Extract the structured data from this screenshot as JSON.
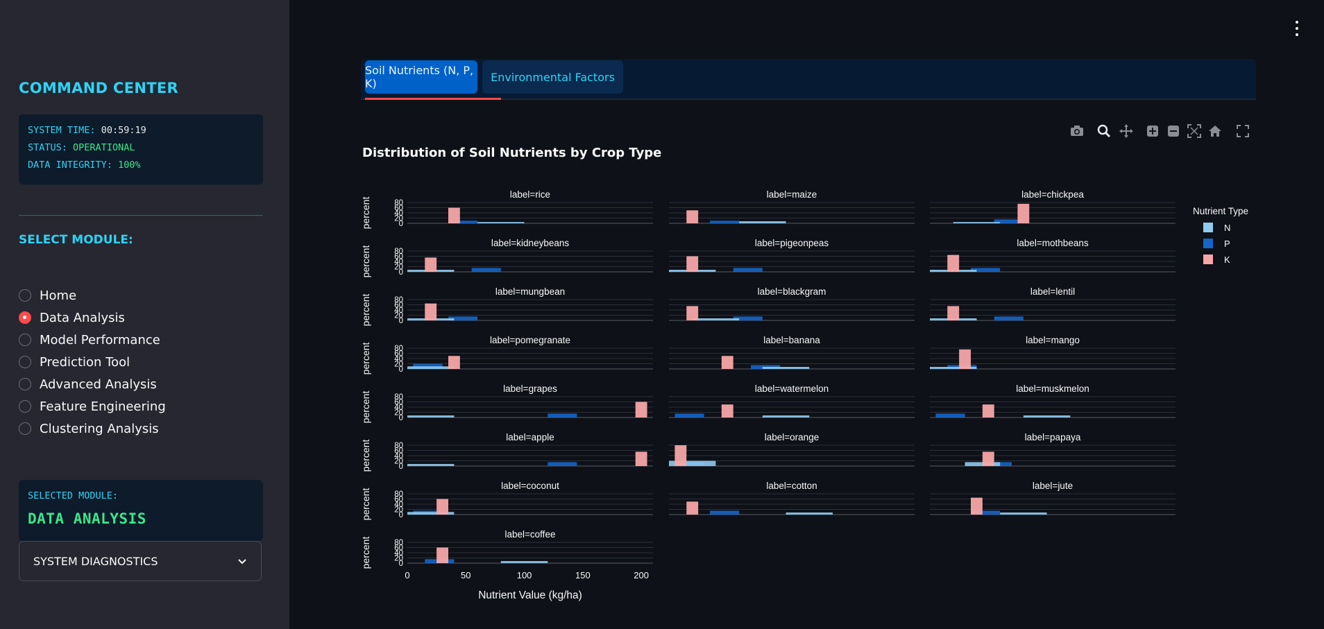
{
  "sidebar": {
    "title": "COMMAND CENTER",
    "system": {
      "time_label": "SYSTEM TIME:",
      "time_value": "00:59:19",
      "status_label": "STATUS:",
      "status_value": "OPERATIONAL",
      "integrity_label": "DATA INTEGRITY:",
      "integrity_value": "100%"
    },
    "select_title": "SELECT MODULE:",
    "modules": [
      {
        "label": "Home",
        "selected": false
      },
      {
        "label": "Data Analysis",
        "selected": true
      },
      {
        "label": "Model Performance",
        "selected": false
      },
      {
        "label": "Prediction Tool",
        "selected": false
      },
      {
        "label": "Advanced Analysis",
        "selected": false
      },
      {
        "label": "Feature Engineering",
        "selected": false
      },
      {
        "label": "Clustering Analysis",
        "selected": false
      }
    ],
    "selected_module_label": "SELECTED MODULE:",
    "selected_module_value": "DATA ANALYSIS",
    "diagnostics_label": "SYSTEM DIAGNOSTICS"
  },
  "tabs": [
    {
      "label": "Soil Nutrients (N, P, K)",
      "active": true
    },
    {
      "label": "Environmental Factors",
      "active": false
    }
  ],
  "modebar_icons": [
    "camera-icon",
    "zoom-icon",
    "pan-icon",
    "zoom-in-icon",
    "zoom-out-icon",
    "autoscale-icon",
    "home-icon",
    "fullscreen-icon"
  ],
  "chart_data": {
    "type": "histogram",
    "title": "Distribution of Soil Nutrients by Crop Type",
    "xlabel": "Nutrient Value (kg/ha)",
    "ylabel": "percent",
    "xlim": [
      0,
      210
    ],
    "ylim": [
      0,
      80
    ],
    "xticks": [
      0,
      50,
      100,
      150,
      200
    ],
    "yticks": [
      0,
      20,
      40,
      60,
      80
    ],
    "legend": {
      "title": "Nutrient Type",
      "position": "right"
    },
    "colors": {
      "N": "#8fcbf0",
      "P": "#1565c8",
      "K": "#f7a6a6"
    },
    "facets": [
      {
        "label": "label=rice",
        "N": [
          [
            60,
            100,
            5
          ]
        ],
        "P": [
          [
            35,
            60,
            10
          ]
        ],
        "K": [
          [
            35,
            45,
            60
          ]
        ]
      },
      {
        "label": "label=maize",
        "N": [
          [
            60,
            100,
            8
          ]
        ],
        "P": [
          [
            35,
            60,
            10
          ]
        ],
        "K": [
          [
            15,
            25,
            50
          ]
        ]
      },
      {
        "label": "label=chickpea",
        "N": [
          [
            20,
            60,
            5
          ]
        ],
        "P": [
          [
            55,
            80,
            15
          ]
        ],
        "K": [
          [
            75,
            85,
            75
          ]
        ]
      },
      {
        "label": "label=kidneybeans",
        "N": [
          [
            0,
            40,
            8
          ]
        ],
        "P": [
          [
            55,
            80,
            15
          ]
        ],
        "K": [
          [
            15,
            25,
            55
          ]
        ]
      },
      {
        "label": "label=pigeonpeas",
        "N": [
          [
            0,
            40,
            8
          ]
        ],
        "P": [
          [
            55,
            80,
            15
          ]
        ],
        "K": [
          [
            15,
            25,
            60
          ]
        ]
      },
      {
        "label": "label=mothbeans",
        "N": [
          [
            0,
            40,
            8
          ]
        ],
        "P": [
          [
            35,
            60,
            15
          ]
        ],
        "K": [
          [
            15,
            25,
            65
          ]
        ]
      },
      {
        "label": "label=mungbean",
        "N": [
          [
            0,
            40,
            8
          ]
        ],
        "P": [
          [
            35,
            60,
            15
          ]
        ],
        "K": [
          [
            15,
            25,
            65
          ]
        ]
      },
      {
        "label": "label=blackgram",
        "N": [
          [
            20,
            60,
            8
          ]
        ],
        "P": [
          [
            55,
            80,
            15
          ]
        ],
        "K": [
          [
            15,
            25,
            55
          ]
        ]
      },
      {
        "label": "label=lentil",
        "N": [
          [
            0,
            40,
            8
          ]
        ],
        "P": [
          [
            55,
            80,
            15
          ]
        ],
        "K": [
          [
            15,
            25,
            55
          ]
        ]
      },
      {
        "label": "label=pomegranate",
        "N": [
          [
            0,
            40,
            10
          ]
        ],
        "P": [
          [
            5,
            30,
            20
          ]
        ],
        "K": [
          [
            35,
            45,
            50
          ]
        ]
      },
      {
        "label": "label=banana",
        "N": [
          [
            80,
            120,
            8
          ]
        ],
        "P": [
          [
            70,
            95,
            15
          ]
        ],
        "K": [
          [
            45,
            55,
            50
          ]
        ]
      },
      {
        "label": "label=mango",
        "N": [
          [
            0,
            40,
            8
          ]
        ],
        "P": [
          [
            15,
            40,
            15
          ]
        ],
        "K": [
          [
            25,
            35,
            75
          ]
        ]
      },
      {
        "label": "label=grapes",
        "N": [
          [
            0,
            40,
            8
          ]
        ],
        "P": [
          [
            120,
            145,
            15
          ]
        ],
        "K": [
          [
            195,
            205,
            60
          ]
        ]
      },
      {
        "label": "label=watermelon",
        "N": [
          [
            80,
            120,
            8
          ]
        ],
        "P": [
          [
            5,
            30,
            15
          ]
        ],
        "K": [
          [
            45,
            55,
            50
          ]
        ]
      },
      {
        "label": "label=muskmelon",
        "N": [
          [
            80,
            120,
            8
          ]
        ],
        "P": [
          [
            5,
            30,
            15
          ]
        ],
        "K": [
          [
            45,
            55,
            50
          ]
        ]
      },
      {
        "label": "label=apple",
        "N": [
          [
            0,
            40,
            8
          ]
        ],
        "P": [
          [
            120,
            145,
            15
          ]
        ],
        "K": [
          [
            195,
            205,
            55
          ]
        ]
      },
      {
        "label": "label=orange",
        "N": [
          [
            0,
            40,
            20
          ]
        ],
        "P": [
          [
            5,
            30,
            15
          ]
        ],
        "K": [
          [
            5,
            15,
            80
          ]
        ]
      },
      {
        "label": "label=papaya",
        "N": [
          [
            30,
            60,
            15
          ]
        ],
        "P": [
          [
            45,
            70,
            15
          ]
        ],
        "K": [
          [
            45,
            55,
            55
          ]
        ]
      },
      {
        "label": "label=coconut",
        "N": [
          [
            0,
            40,
            10
          ]
        ],
        "P": [
          [
            5,
            30,
            15
          ]
        ],
        "K": [
          [
            25,
            35,
            60
          ]
        ]
      },
      {
        "label": "label=cotton",
        "N": [
          [
            100,
            140,
            8
          ]
        ],
        "P": [
          [
            35,
            60,
            15
          ]
        ],
        "K": [
          [
            15,
            25,
            50
          ]
        ]
      },
      {
        "label": "label=jute",
        "N": [
          [
            60,
            100,
            8
          ]
        ],
        "P": [
          [
            35,
            60,
            15
          ]
        ],
        "K": [
          [
            35,
            45,
            65
          ]
        ]
      },
      {
        "label": "label=coffee",
        "N": [
          [
            80,
            120,
            8
          ]
        ],
        "P": [
          [
            15,
            40,
            15
          ]
        ],
        "K": [
          [
            25,
            35,
            60
          ]
        ]
      }
    ]
  }
}
